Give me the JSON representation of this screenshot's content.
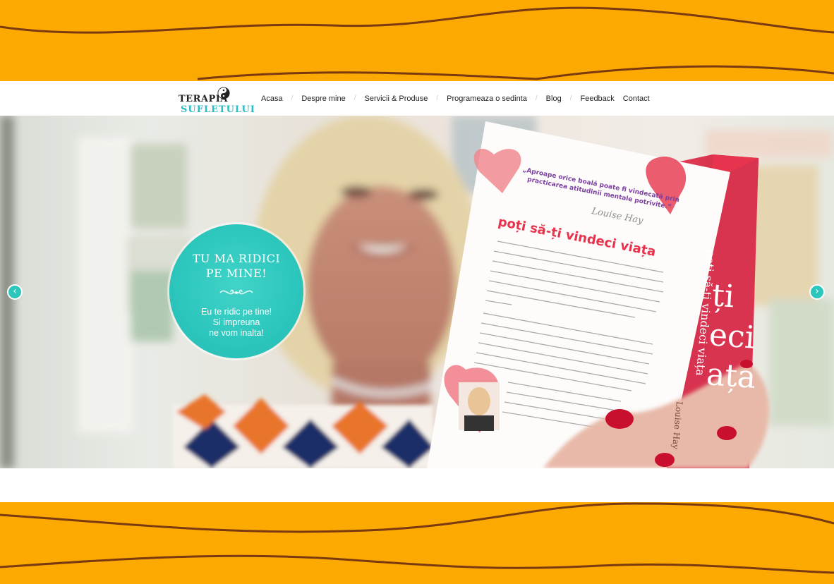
{
  "brand": {
    "line1": "TERAPIA",
    "line2": "SUFLETULUI"
  },
  "nav": {
    "items": [
      {
        "label": "Acasa",
        "icon": ""
      },
      {
        "label": "Despre mine"
      },
      {
        "label": "Servicii & Produse"
      },
      {
        "label": "Programeaza o sedinta"
      },
      {
        "label": "Blog"
      },
      {
        "label": "Feedback"
      },
      {
        "label": "Contact"
      }
    ],
    "separator": "/"
  },
  "slider": {
    "badge": {
      "title_line1": "TU MA RIDICI",
      "title_line2": "PE MINE!",
      "text_line1": "Eu te ridic pe tine!",
      "text_line2": "Si impreuna",
      "text_line3": "ne vom inalta!"
    },
    "book": {
      "quote_line1": "„Aproape orice boală poate fi vindecată prin",
      "quote_line2": "practicarea atitudinii mentale potrivite.”",
      "signature": "Louise Hay",
      "title": "poți să-ți vindeci viața",
      "spine_title": "poți să-ți vindeci viața",
      "spine_author": "Louise Hay",
      "cover_text": "ți\neci\nața"
    },
    "prev_icon": "chevron-left-icon",
    "next_icon": "chevron-right-icon",
    "prev_glyph": "‹",
    "next_glyph": "›"
  },
  "colors": {
    "background": "#fca902",
    "wave_line": "#7a3a10",
    "accent": "#2cc6bd",
    "book_red": "#e8334e"
  }
}
